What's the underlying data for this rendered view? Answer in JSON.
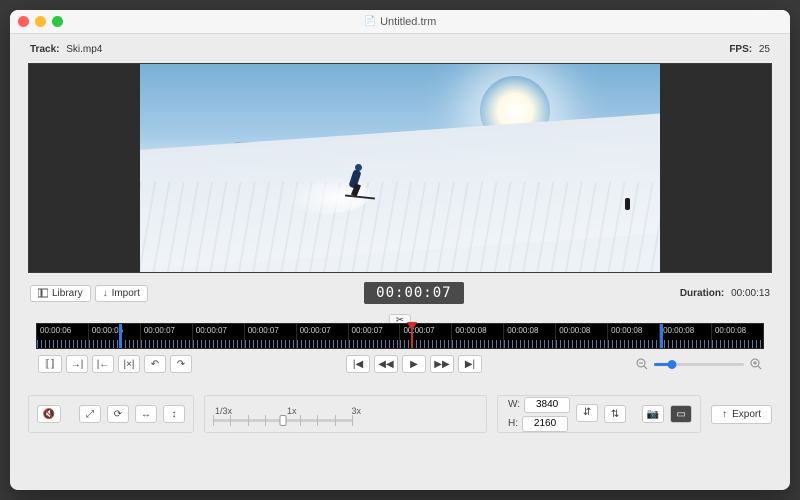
{
  "window": {
    "title": "Untitled.trm"
  },
  "header": {
    "track_label": "Track:",
    "track_name": "Ski.mp4",
    "fps_label": "FPS:",
    "fps_value": "25"
  },
  "preview": {
    "timecode": "00:00:07",
    "duration_label": "Duration:",
    "duration_value": "00:00:13",
    "library_label": "Library",
    "import_label": "Import"
  },
  "timeline": {
    "ticks": [
      "00:00:06",
      "00:00:06",
      "00:00:07",
      "00:00:07",
      "00:00:07",
      "00:00:07",
      "00:00:07",
      "00:00:07",
      "00:00:08",
      "00:00:08",
      "00:00:08",
      "00:00:08",
      "00:00:08",
      "00:00:08"
    ],
    "scissors_icon": "scissors-icon"
  },
  "trimbar": {
    "icons": {
      "bracket_both": "bracket-both-icon",
      "in": "set-in-icon",
      "out": "set-out-icon",
      "clear": "clear-range-icon",
      "undo": "undo-icon",
      "redo": "redo-icon"
    }
  },
  "playback": {
    "icons": {
      "start": "go-start-icon",
      "prev": "step-back-icon",
      "play": "play-icon",
      "next": "step-forward-icon",
      "end": "go-end-icon"
    }
  },
  "zoom": {
    "out_icon": "zoom-out-icon",
    "in_icon": "zoom-in-icon",
    "value_pct": 20
  },
  "speed": {
    "labels": {
      "slow": "1/3x",
      "normal": "1x",
      "fast": "3x"
    }
  },
  "audio_tools": {
    "mute_icon": "mute-icon",
    "expand_icon": "expand-icon",
    "rotate_icon": "rotate-icon",
    "flip_h_icon": "flip-horizontal-icon",
    "flip_v_icon": "flip-vertical-icon"
  },
  "dimensions": {
    "w_label": "W:",
    "h_label": "H:",
    "w": "3840",
    "h": "2160",
    "lock_icon": "link-icon",
    "swap_icon": "swap-icon",
    "camera_icon": "camera-icon",
    "frame_icon": "frame-icon"
  },
  "export": {
    "label": "Export",
    "icon": "export-icon"
  },
  "colors": {
    "accent": "#2f7ae5",
    "playhead": "#d52b2b"
  }
}
